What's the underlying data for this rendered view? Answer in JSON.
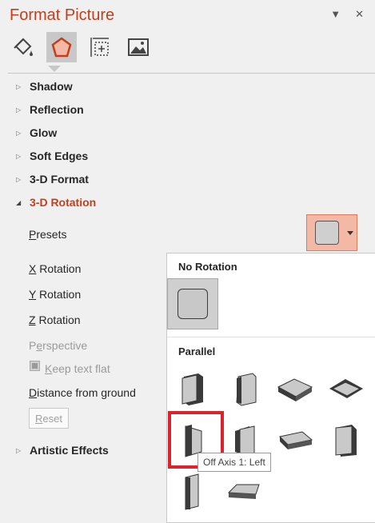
{
  "pane": {
    "title": "Format Picture"
  },
  "window": {
    "dropdown_icon": "chevron-down-icon",
    "close_icon": "close-icon"
  },
  "tabs": [
    {
      "name": "fill-line",
      "icon": "paint-bucket-icon"
    },
    {
      "name": "effects",
      "icon": "pentagon-icon",
      "active": true
    },
    {
      "name": "size-properties",
      "icon": "size-icon"
    },
    {
      "name": "picture",
      "icon": "picture-icon"
    }
  ],
  "sections": {
    "shadow": "Shadow",
    "reflection": "Reflection",
    "glow": "Glow",
    "soft_edges": "Soft Edges",
    "format3d": "3-D Format",
    "rotation3d": "3-D Rotation",
    "artistic": "Artistic Effects"
  },
  "rotation": {
    "presets_label": "Presets",
    "x_label": "X Rotation",
    "y_label": "Y Rotation",
    "z_label": "Z Rotation",
    "perspective_label": "Perspective",
    "keep_flat_label": "Keep text flat",
    "distance_label": "Distance from ground",
    "reset_label": "Reset"
  },
  "gallery": {
    "no_rotation_header": "No Rotation",
    "parallel_header": "Parallel",
    "tooltip": "Off Axis 1: Left"
  },
  "colors": {
    "accent": "#c43e1c",
    "highlight": "#d9232e",
    "preset_bg": "#f4b9a6"
  }
}
